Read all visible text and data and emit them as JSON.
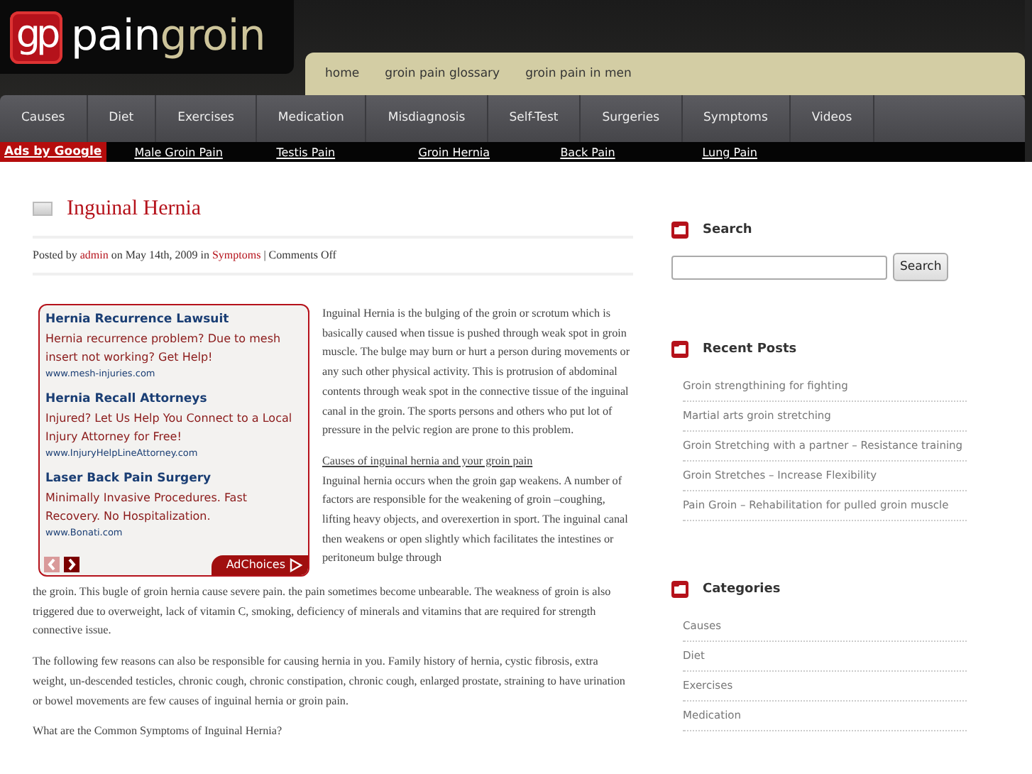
{
  "logo": {
    "mark": "gp",
    "text_a": "pain",
    "text_b": "groin"
  },
  "top_nav": [
    {
      "label": "home"
    },
    {
      "label": "groin pain glossary"
    },
    {
      "label": "groin pain in men"
    }
  ],
  "category_nav": [
    {
      "label": "Causes"
    },
    {
      "label": "Diet"
    },
    {
      "label": "Exercises"
    },
    {
      "label": "Medication"
    },
    {
      "label": "Misdiagnosis"
    },
    {
      "label": "Self-Test"
    },
    {
      "label": "Surgeries"
    },
    {
      "label": "Symptoms"
    },
    {
      "label": "Videos"
    }
  ],
  "ads_bar": {
    "label": "Ads by Google",
    "links": [
      "Male Groin Pain",
      "Testis Pain",
      "Groin Hernia",
      "Back Pain",
      "Lung Pain"
    ]
  },
  "post": {
    "title": "Inguinal Hernia",
    "meta": {
      "posted_by": "Posted by",
      "author": "admin",
      "date": "on May 14th, 2009 in",
      "category": "Symptoms",
      "separator": "|",
      "comments": "Comments Off"
    },
    "ad_box": {
      "ads": [
        {
          "title": "Hernia Recurrence Lawsuit",
          "text": "Hernia recurrence problem? Due to mesh insert not working? Get Help!",
          "url": "www.mesh-injuries.com"
        },
        {
          "title": "Hernia Recall Attorneys",
          "text": "Injured? Let Us Help You Connect to a Local Injury Attorney for Free!",
          "url": "www.InjuryHelpLineAttorney.com"
        },
        {
          "title": "Laser Back Pain Surgery",
          "text": "Minimally Invasive Procedures. Fast Recovery. No Hospitalization.",
          "url": "www.Bonati.com"
        }
      ],
      "prev_disabled": true,
      "next_disabled": false,
      "adchoices": "AdChoices"
    },
    "blocks": [
      {
        "kind": "paragraph",
        "text": "Inguinal Hernia is the bulging of the groin or scrotum which is basically caused when tissue is pushed through weak spot in groin muscle. The bulge may burn or hurt a person during movements or any such other physical activity. This is protrusion of abdominal contents through weak spot in the connective tissue of the inguinal canal in the groin. The sports persons and others who put lot of pressure in the pelvic region are prone to this problem."
      },
      {
        "kind": "link_heading",
        "text": "Causes of inguinal hernia and your groin pain"
      },
      {
        "kind": "paragraph_tight",
        "text": "Inguinal hernia occurs when the groin gap weakens. A number of factors are responsible for the weakening of groin –coughing, lifting heavy objects, and overexertion in sport. The inguinal canal then weakens or open slightly which facilitates the intestines or peritoneum bulge through"
      },
      {
        "kind": "paragraph",
        "text": "the groin. This bugle of groin hernia cause severe pain. the pain sometimes become unbearable. The weakness of groin is also triggered due to overweight, lack of vitamin C, smoking, deficiency of minerals and vitamins that are required for strength connective issue."
      },
      {
        "kind": "paragraph",
        "text": "The following few reasons can also be responsible for causing hernia in you. Family history of hernia, cystic fibrosis, extra weight, un-descended testicles, chronic cough, chronic constipation, chronic cough, enlarged prostate, straining to have urination or bowel movements are few causes of inguinal hernia or groin pain."
      },
      {
        "kind": "paragraph",
        "text": "What are the Common Symptoms of Inguinal Hernia?"
      }
    ]
  },
  "sidebar": {
    "search": {
      "heading": "Search",
      "button": "Search"
    },
    "recent_posts": {
      "heading": "Recent Posts",
      "items": [
        "Groin strengthining for fighting",
        "Martial arts groin stretching",
        "Groin Stretching with a partner – Resistance training",
        "Groin Stretches – Increase Flexibility",
        "Pain Groin – Rehabilitation for pulled groin muscle"
      ]
    },
    "categories": {
      "heading": "Categories",
      "items": [
        "Causes",
        "Diet",
        "Exercises",
        "Medication"
      ]
    }
  }
}
